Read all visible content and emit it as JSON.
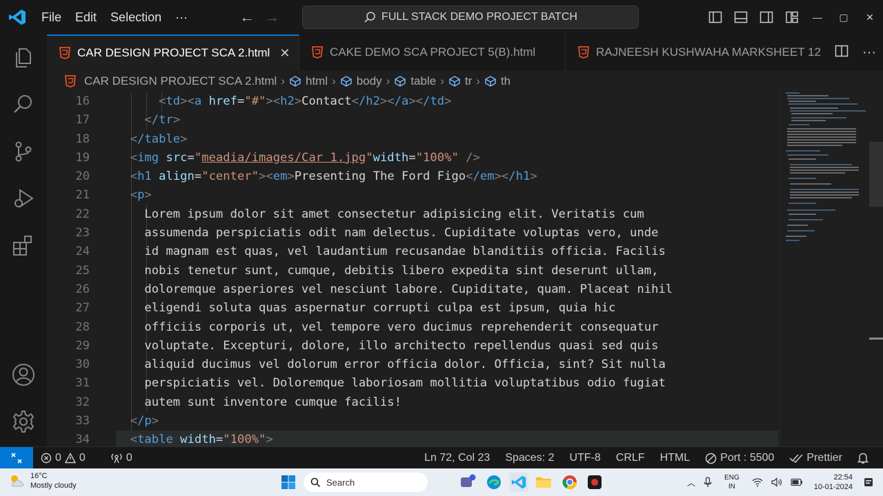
{
  "menu": {
    "file": "File",
    "edit": "Edit",
    "selection": "Selection",
    "more": "···"
  },
  "command_center": {
    "label": "FULL STACK DEMO PROJECT BATCH"
  },
  "tabs": [
    {
      "label": "CAR DESIGN PROJECT SCA 2.html",
      "active": true
    },
    {
      "label": "CAKE DEMO SCA PROJECT 5(B).html",
      "active": false
    },
    {
      "label": "RAJNEESH KUSHWAHA MARKSHEET 12",
      "active": false
    }
  ],
  "breadcrumb": [
    "CAR DESIGN PROJECT SCA 2.html",
    "html",
    "body",
    "table",
    "tr",
    "th"
  ],
  "editor": {
    "line_numbers": [
      "16",
      "17",
      "18",
      "19",
      "20",
      "21",
      "22",
      "23",
      "24",
      "25",
      "26",
      "27",
      "28",
      "29",
      "30",
      "31",
      "32",
      "33",
      "34"
    ],
    "lines": {
      "l16": {
        "td_open": "td",
        "a_open": "a",
        "href_attr": "href",
        "href_val": "\"#\"",
        "h2_open": "h2",
        "text": "Contact",
        "h2_close": "/h2",
        "a_close": "/a",
        "td_close": "/td"
      },
      "l17": {
        "tr_close": "/tr"
      },
      "l18": {
        "table_close": "/table"
      },
      "l19": {
        "img": "img",
        "src_attr": "src",
        "src_val": "meadia/images/Car 1.jpg",
        "width_attr": "width",
        "width_val": "\"100%\""
      },
      "l20": {
        "h1": "h1",
        "align_attr": "align",
        "align_val": "\"center\"",
        "em": "em",
        "text": "Presenting The Ford Figo",
        "em_close": "/em",
        "h1_close": "/h1"
      },
      "l21": {
        "p": "p"
      },
      "paragraph": [
        "Lorem ipsum dolor sit amet consectetur adipisicing elit. Veritatis cum",
        "assumenda perspiciatis odit nam delectus. Cupiditate voluptas vero, unde",
        "id magnam est quas, vel laudantium recusandae blanditiis officia. Facilis",
        "nobis tenetur sunt, cumque, debitis libero expedita sint deserunt ullam,",
        "doloremque asperiores vel nesciunt labore. Cupiditate, quam. Placeat nihil",
        "eligendi soluta quas aspernatur corrupti culpa est ipsum, quia hic",
        "officiis corporis ut, vel tempore vero ducimus reprehenderit consequatur",
        "voluptate. Excepturi, dolore, illo architecto repellendus quasi sed quis",
        "aliquid ducimus vel dolorum error officia dolor. Officia, sint? Sit nulla",
        "perspiciatis vel. Doloremque laboriosam mollitia voluptatibus odio fugiat",
        "autem sunt inventore cumque facilis!"
      ],
      "l33": {
        "p_close": "/p"
      },
      "l34": {
        "table": "table",
        "width_attr": "width",
        "width_val": "\"100%\""
      }
    }
  },
  "statusbar": {
    "errors": "0",
    "warnings": "0",
    "ports": "0",
    "position": "Ln 72, Col 23",
    "spaces": "Spaces: 2",
    "encoding": "UTF-8",
    "eol": "CRLF",
    "language": "HTML",
    "port": "Port : 5500",
    "prettier": "Prettier"
  },
  "taskbar": {
    "temperature": "16°C",
    "weather": "Mostly cloudy",
    "search": "Search",
    "lang1": "ENG",
    "lang2": "IN",
    "time": "22:54",
    "date": "10-01-2024"
  },
  "colors": {
    "accent": "#0078d4",
    "html_icon": "#e44d26",
    "tag": "#569cd6",
    "attr": "#9cdcfe",
    "string": "#ce9178"
  }
}
